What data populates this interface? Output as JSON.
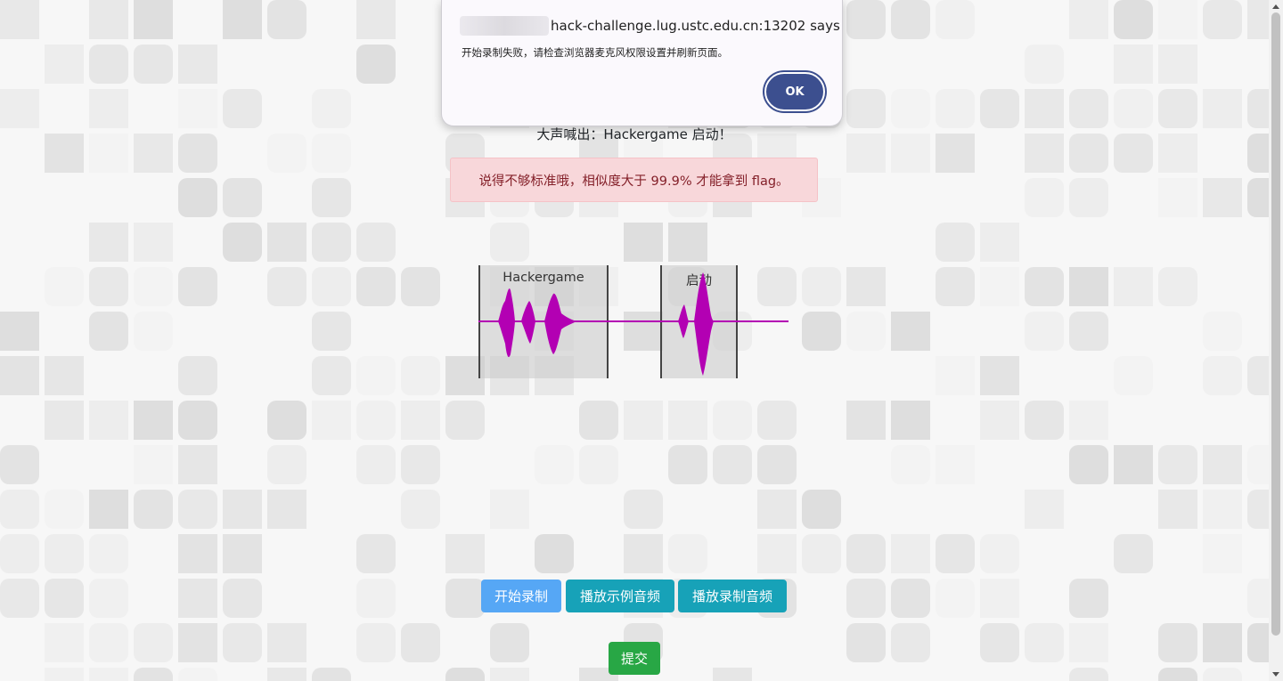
{
  "dialog": {
    "title": "hack-challenge.lug.ustc.edu.cn:13202 says",
    "message": "开始录制失败，请检查浏览器麦克风权限设置并刷新页面。",
    "ok_label": "OK"
  },
  "main": {
    "prompt": "大声喊出：Hackergame 启动！",
    "alert": "说得不够标准哦，相似度大于 99.9% 才能拿到 flag。"
  },
  "waveform": {
    "segments": [
      {
        "label": "Hackergame"
      },
      {
        "label": "启动"
      }
    ],
    "wave_color": "#b300b3"
  },
  "buttons": {
    "record": "开始录制",
    "play_sample": "播放示例音频",
    "play_recording": "播放录制音频",
    "submit": "提交"
  },
  "colors": {
    "record_button": "#56a7f5",
    "play_buttons": "#17a2b8",
    "submit_button": "#28a745",
    "alert_bg": "#f8d7da",
    "dialog_ok": "#3c4f8f"
  }
}
